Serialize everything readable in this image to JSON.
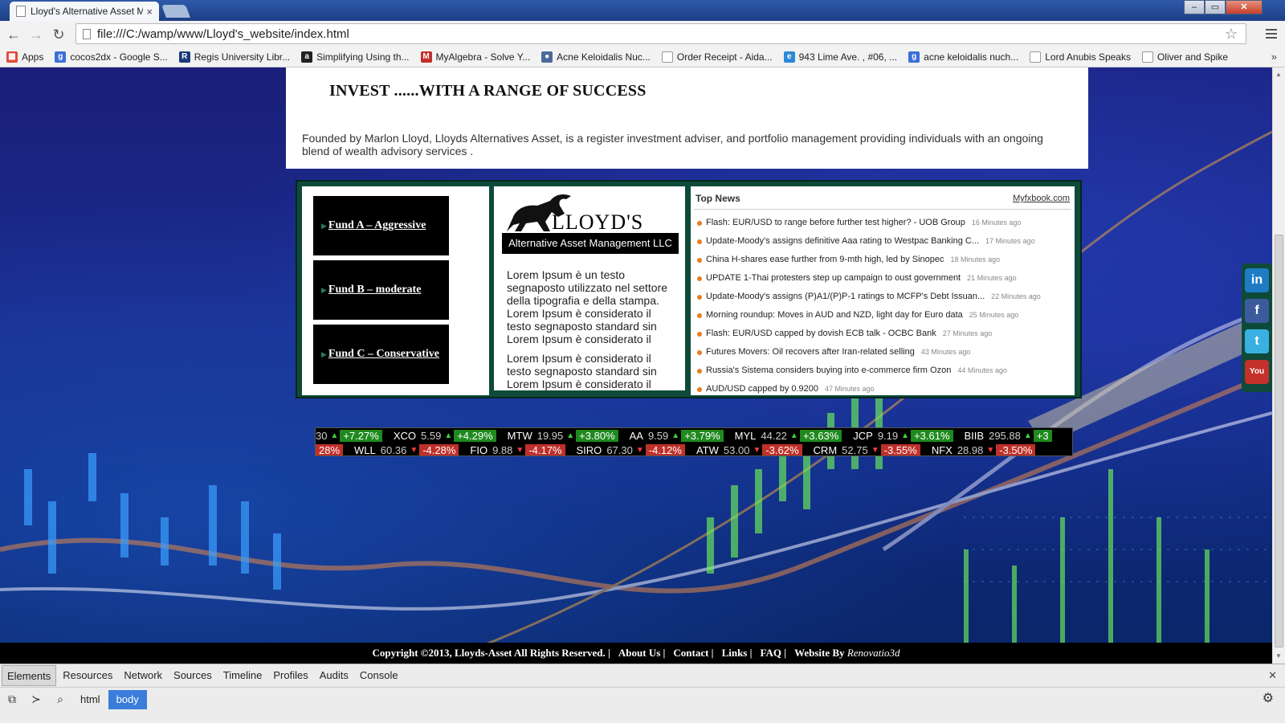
{
  "browser": {
    "tab_title": "Lloyd's Alternative Asset M",
    "url": "file:///C:/wamp/www/Lloyd's_website/index.html",
    "bookmarks": [
      {
        "label": "Apps",
        "color": "#e04a3a",
        "glyph": "▦"
      },
      {
        "label": "cocos2dx - Google S...",
        "color": "#3b6fd8",
        "glyph": "g"
      },
      {
        "label": "Regis University Libr...",
        "color": "#1b3a7a",
        "glyph": "R"
      },
      {
        "label": "Simplifying Using th...",
        "color": "#222222",
        "glyph": "a"
      },
      {
        "label": "MyAlgebra - Solve Y...",
        "color": "#c0302a",
        "glyph": "M"
      },
      {
        "label": "Acne Keloidalis Nuc...",
        "color": "#4a6a9a",
        "glyph": "●"
      },
      {
        "label": "Order Receipt - Aida...",
        "color": "#ffffff",
        "glyph": ""
      },
      {
        "label": "943 Lime Ave. , #06, ...",
        "color": "#2a8ad8",
        "glyph": "e"
      },
      {
        "label": "acne keloidalis nuch...",
        "color": "#3b6fd8",
        "glyph": "g"
      },
      {
        "label": "Lord Anubis Speaks",
        "color": "#ffffff",
        "glyph": ""
      },
      {
        "label": "Oliver and Spike",
        "color": "#ffffff",
        "glyph": ""
      }
    ],
    "bookmarks_more": "»"
  },
  "page": {
    "headline": "INVEST ......WITH A RANGE OF SUCCESS",
    "intro": "Founded by Marlon Lloyd, Lloyds Alternatives Asset, is a register investment adviser, and portfolio management providing individuals with an ongoing blend of wealth advisory services .",
    "funds": [
      {
        "label": "Fund A – Aggressive"
      },
      {
        "label": "Fund B – moderate"
      },
      {
        "label": "Fund C – Conservative"
      }
    ],
    "logo_name": "LLOYD'S",
    "logo_subtitle": "Alternative Asset Management LLC",
    "lorem_1": "Lorem Ipsum è un testo segnaposto utilizzato nel settore della tipografia e della stampa. Lorem Ipsum è considerato il testo segnaposto standard sin Lorem Ipsum è considerato il",
    "lorem_2": "Lorem Ipsum è considerato il testo segnaposto standard sin Lorem Ipsum è considerato il",
    "news": {
      "title": "Top News",
      "source": "Myfxbook.com",
      "items": [
        {
          "headline": "Flash: EUR/USD to range before further test higher? - UOB Group",
          "ago": "16 Minutes ago"
        },
        {
          "headline": "Update-Moody's assigns definitive Aaa rating to Westpac Banking C...",
          "ago": "17 Minutes ago"
        },
        {
          "headline": "China H-shares ease further from 9-mth high, led by Sinopec",
          "ago": "18 Minutes ago"
        },
        {
          "headline": "UPDATE 1-Thai protesters step up campaign to oust government",
          "ago": "21 Minutes ago"
        },
        {
          "headline": "Update-Moody's assigns (P)A1/(P)P-1 ratings to MCFP's Debt Issuan...",
          "ago": "22 Minutes ago"
        },
        {
          "headline": "Morning roundup: Moves in AUD and NZD, light day for Euro data",
          "ago": "25 Minutes ago"
        },
        {
          "headline": "Flash: EUR/USD capped by dovish ECB talk - OCBC Bank",
          "ago": "27 Minutes ago"
        },
        {
          "headline": "Futures Movers: Oil recovers after Iran-related selling",
          "ago": "43 Minutes ago"
        },
        {
          "headline": "Russia's Sistema considers buying into e-commerce firm Ozon",
          "ago": "44 Minutes ago"
        },
        {
          "headline": "AUD/USD capped by 0.9200",
          "ago": "47 Minutes ago"
        }
      ]
    },
    "ticker_gainers_lead": "30",
    "ticker_gainers_lead_change": "+7.27%",
    "ticker_gainers": [
      {
        "symbol": "XCO",
        "price": "5.59",
        "change": "+4.29%"
      },
      {
        "symbol": "MTW",
        "price": "19.95",
        "change": "+3.80%"
      },
      {
        "symbol": "AA",
        "price": "9.59",
        "change": "+3.79%"
      },
      {
        "symbol": "MYL",
        "price": "44.22",
        "change": "+3.63%"
      },
      {
        "symbol": "JCP",
        "price": "9.19",
        "change": "+3.61%"
      },
      {
        "symbol": "BIIB",
        "price": "295.88",
        "change": "+3"
      }
    ],
    "ticker_losers_lead_change": "28%",
    "ticker_losers": [
      {
        "symbol": "WLL",
        "price": "60.36",
        "change": "-4.28%"
      },
      {
        "symbol": "FIO",
        "price": "9.88",
        "change": "-4.17%"
      },
      {
        "symbol": "SIRO",
        "price": "67.30",
        "change": "-4.12%"
      },
      {
        "symbol": "ATW",
        "price": "53.00",
        "change": "-3.62%"
      },
      {
        "symbol": "CRM",
        "price": "52.75",
        "change": "-3.55%"
      },
      {
        "symbol": "NFX",
        "price": "28.98",
        "change": "-3.50%"
      }
    ],
    "social": [
      {
        "name": "linkedin",
        "glyph": "in",
        "color": "#1f7bc4"
      },
      {
        "name": "facebook",
        "glyph": "f",
        "color": "#3b5b9d"
      },
      {
        "name": "twitter",
        "glyph": "t",
        "color": "#3ab0e2"
      },
      {
        "name": "youtube",
        "glyph": "You",
        "color": "#c4302b"
      }
    ],
    "footer": {
      "copyright": "Copyright ©2013, Lloyds-Asset All Rights Reserved. |",
      "about": "About Us |",
      "contact": "Contact |",
      "links": "Links |",
      "faq": "FAQ |",
      "credit_prefix": "Website By",
      "credit_name": "Renovatio3d"
    }
  },
  "devtools": {
    "tabs": [
      "Elements",
      "Resources",
      "Network",
      "Sources",
      "Timeline",
      "Profiles",
      "Audits",
      "Console"
    ],
    "breadcrumbs": [
      "html",
      "body"
    ]
  }
}
